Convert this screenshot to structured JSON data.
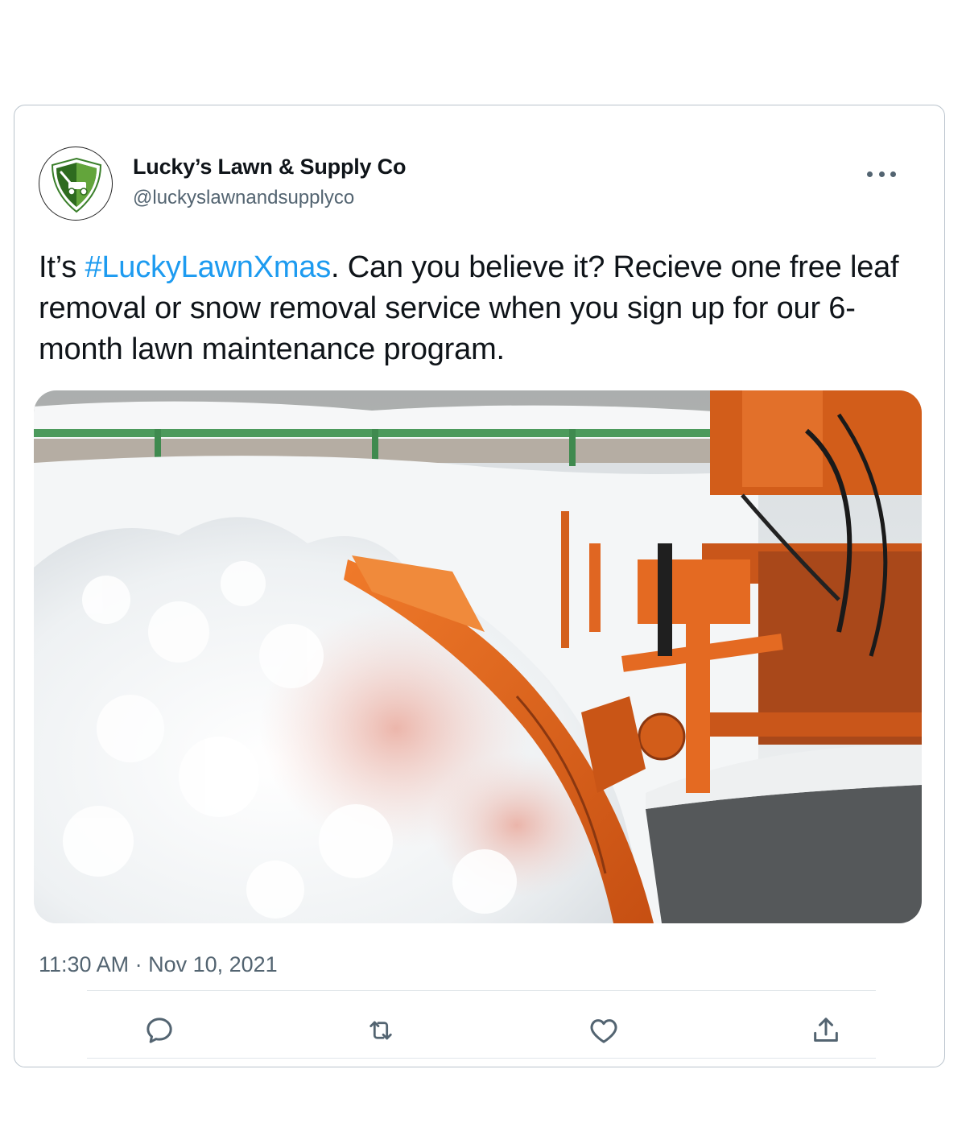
{
  "tweet": {
    "display_name": "Lucky’s Lawn & Supply Co",
    "handle": "@luckyslawnandsupplyco",
    "text_before": "It’s ",
    "hashtag": "#LuckyLawnXmas",
    "text_after": ". Can you believe it? Recieve one free leaf removal or snow removal service when you sign up for our 6-month lawn maintenance program.",
    "timestamp": "11:30 AM · Nov 10, 2021"
  },
  "icons": {
    "avatar": "lawnmower-shield-logo",
    "more": "more-options-icon",
    "reply": "reply-icon",
    "retweet": "retweet-icon",
    "like": "like-icon",
    "share": "share-icon"
  },
  "colors": {
    "hashtag": "#1d9bf0",
    "secondary_text": "#536471",
    "logo_green_dark": "#2e6b1f",
    "logo_green_light": "#63a53b",
    "plow_orange": "#e0651c"
  }
}
